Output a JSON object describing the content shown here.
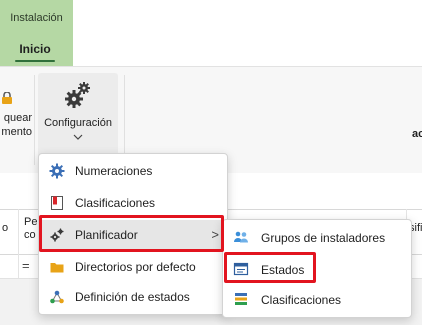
{
  "ribbon": {
    "group_label": "Instalación",
    "active_tab": "Inicio",
    "partial_button_lines": [
      "quear",
      "mento"
    ],
    "config_button_label": "Configuración"
  },
  "table": {
    "header_partial_left": "o",
    "header_partial_pe": "Pe",
    "header_partial_co": "co",
    "header_partial_right": "sifi",
    "filter_symbol": "=",
    "right_cell_partial": "ac"
  },
  "menu": {
    "items": [
      {
        "label": "Numeraciones",
        "icon": "gear-icon"
      },
      {
        "label": "Clasificaciones",
        "icon": "bookmark-icon"
      },
      {
        "label": "Planificador",
        "icon": "gears-icon",
        "submenu_arrow": ">"
      },
      {
        "label": "Directorios por defecto",
        "icon": "folder-icon"
      },
      {
        "label": "Definición de estados",
        "icon": "network-icon"
      }
    ]
  },
  "submenu": {
    "items": [
      {
        "label": "Grupos de instaladores",
        "icon": "users-icon"
      },
      {
        "label": "Estados",
        "icon": "status-card-icon"
      },
      {
        "label": "Clasificaciones",
        "icon": "stack-icon"
      }
    ]
  },
  "colors": {
    "ribbon_green": "#b5d8a4",
    "highlight_red": "#e2141f",
    "menu_hover": "#e6e6e6"
  }
}
